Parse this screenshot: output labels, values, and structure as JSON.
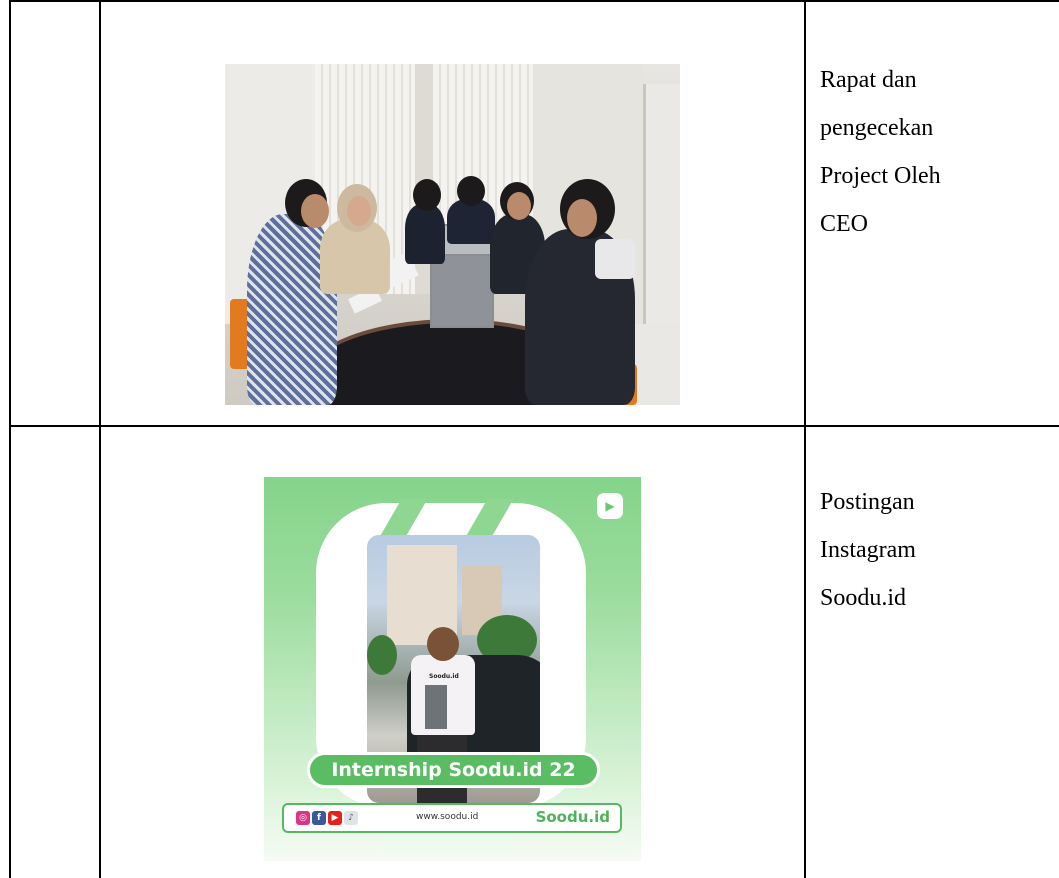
{
  "rows": [
    {
      "caption_lines": [
        "Rapat dan",
        "pengecekan",
        "Project Oleh",
        "CEO"
      ]
    },
    {
      "caption_lines": [
        "Postingan",
        "Instagram",
        "Soodu.id"
      ],
      "post": {
        "banner": "Internship Soodu.id 22",
        "shirt_text": "Soodu.id",
        "url": "www.soodu.id",
        "brand": "Soodu.id",
        "accent": "#5bbd63"
      }
    }
  ]
}
